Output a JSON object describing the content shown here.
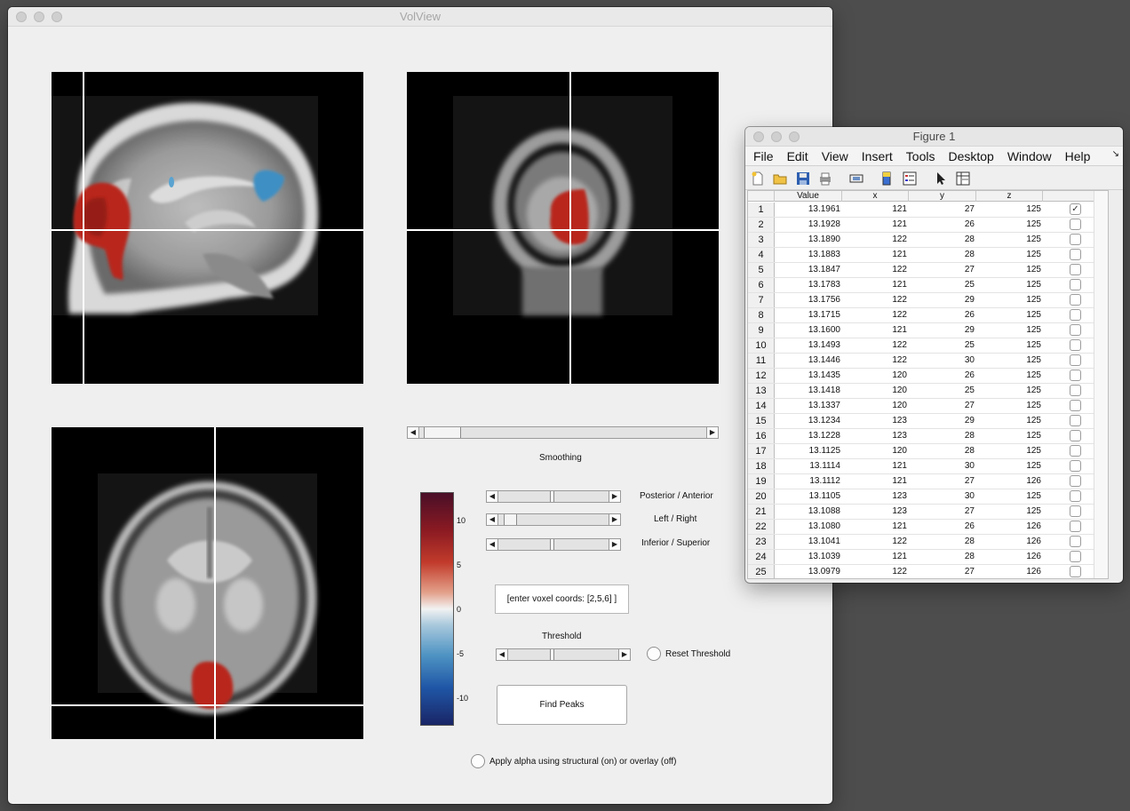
{
  "volview": {
    "title": "VolView",
    "smoothing_label": "Smoothing",
    "sliders": [
      {
        "label": "Posterior / Anterior",
        "level": 0.5
      },
      {
        "label": "Left / Right",
        "level": 0.1
      },
      {
        "label": "Inferior / Superior",
        "level": 0.5
      }
    ],
    "smoothing_level": 0.0,
    "voxel_input": "[enter voxel coords: [2,5,6] ]",
    "threshold_label": "Threshold",
    "threshold_level": 0.4,
    "reset_threshold_label": "Reset Threshold",
    "find_peaks_label": "Find Peaks",
    "apply_alpha_label": "Apply alpha using structural (on) or overlay (off)",
    "colorbar_ticks": [
      "10",
      "5",
      "0",
      "-5",
      "-10"
    ],
    "colors": {
      "positive": "#b8281f",
      "negative": "#3d8fc4",
      "crosshair": "#ffffff"
    }
  },
  "figure": {
    "title": "Figure 1",
    "menu": [
      "File",
      "Edit",
      "View",
      "Insert",
      "Tools",
      "Desktop",
      "Window",
      "Help"
    ],
    "toolbar_icons": [
      "new-file-icon",
      "open-folder-icon",
      "save-icon",
      "print-icon",
      "link-icon",
      "colorbar-icon",
      "legend-icon",
      "pointer-icon",
      "property-editor-icon"
    ],
    "columns": [
      "Value",
      "x",
      "y",
      "z",
      ""
    ],
    "rows": [
      [
        "1",
        "13.1961",
        "121",
        "27",
        "125",
        true
      ],
      [
        "2",
        "13.1928",
        "121",
        "26",
        "125",
        false
      ],
      [
        "3",
        "13.1890",
        "122",
        "28",
        "125",
        false
      ],
      [
        "4",
        "13.1883",
        "121",
        "28",
        "125",
        false
      ],
      [
        "5",
        "13.1847",
        "122",
        "27",
        "125",
        false
      ],
      [
        "6",
        "13.1783",
        "121",
        "25",
        "125",
        false
      ],
      [
        "7",
        "13.1756",
        "122",
        "29",
        "125",
        false
      ],
      [
        "8",
        "13.1715",
        "122",
        "26",
        "125",
        false
      ],
      [
        "9",
        "13.1600",
        "121",
        "29",
        "125",
        false
      ],
      [
        "10",
        "13.1493",
        "122",
        "25",
        "125",
        false
      ],
      [
        "11",
        "13.1446",
        "122",
        "30",
        "125",
        false
      ],
      [
        "12",
        "13.1435",
        "120",
        "26",
        "125",
        false
      ],
      [
        "13",
        "13.1418",
        "120",
        "25",
        "125",
        false
      ],
      [
        "14",
        "13.1337",
        "120",
        "27",
        "125",
        false
      ],
      [
        "15",
        "13.1234",
        "123",
        "29",
        "125",
        false
      ],
      [
        "16",
        "13.1228",
        "123",
        "28",
        "125",
        false
      ],
      [
        "17",
        "13.1125",
        "120",
        "28",
        "125",
        false
      ],
      [
        "18",
        "13.1114",
        "121",
        "30",
        "125",
        false
      ],
      [
        "19",
        "13.1112",
        "121",
        "27",
        "126",
        false
      ],
      [
        "20",
        "13.1105",
        "123",
        "30",
        "125",
        false
      ],
      [
        "21",
        "13.1088",
        "123",
        "27",
        "125",
        false
      ],
      [
        "22",
        "13.1080",
        "121",
        "26",
        "126",
        false
      ],
      [
        "23",
        "13.1041",
        "122",
        "28",
        "126",
        false
      ],
      [
        "24",
        "13.1039",
        "121",
        "28",
        "126",
        false
      ],
      [
        "25",
        "13.0979",
        "122",
        "27",
        "126",
        false
      ]
    ]
  }
}
